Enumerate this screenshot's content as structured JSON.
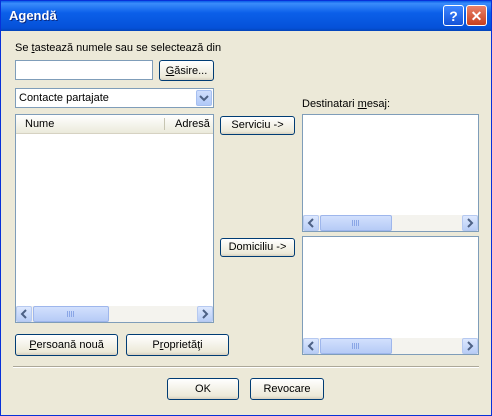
{
  "window": {
    "title": "Agendă",
    "help_label": "?",
    "close_label": "✕"
  },
  "search": {
    "prompt_before": "Se ",
    "prompt_access": "t",
    "prompt_after": "astează numele sau se selectează din",
    "value": "",
    "find_access": "G",
    "find_rest": "ăsire..."
  },
  "address_book": {
    "selected": "Contacte partajate"
  },
  "contacts": {
    "columns": [
      "Nume",
      "Adresă"
    ],
    "rows": []
  },
  "actions": {
    "service_label": "Serviciu ->",
    "home_label": "Domiciliu ->"
  },
  "recipients": {
    "label_before": "Destinatari ",
    "label_access": "m",
    "label_after": "esaj:"
  },
  "buttons": {
    "new_person_access": "P",
    "new_person_rest": "ersoană nouă",
    "properties_before": "P",
    "properties_access": "r",
    "properties_rest": "oprietăţi",
    "ok_label": "OK",
    "cancel_label": "Revocare"
  },
  "colors": {
    "titlebar": "#0b5fe9",
    "dialog_bg": "#ece9d8",
    "field_border": "#7f9db9"
  }
}
